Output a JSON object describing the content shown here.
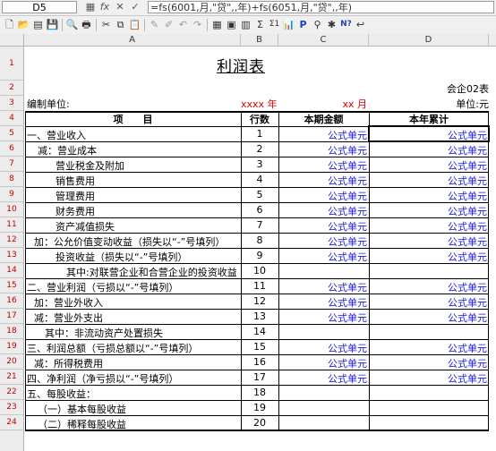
{
  "formula_bar": {
    "cell_ref": "D5",
    "fx_label": "fx",
    "cancel_label": "✕",
    "confirm_label": "✓",
    "formula": "=fs(6001,月,\"贷\",,年)+fs(6051,月,\"贷\",,年)"
  },
  "toolbar": {
    "sigma_label": "Σ",
    "sum_label": "Σ1",
    "p_label": "P",
    "help_label": "N?"
  },
  "columns": [
    "A",
    "B",
    "C",
    "D"
  ],
  "rows": [
    "1",
    "2",
    "3",
    "4",
    "5",
    "6",
    "7",
    "8",
    "9",
    "10",
    "11",
    "12",
    "13",
    "14",
    "15",
    "16",
    "17",
    "18",
    "19",
    "20",
    "21",
    "22",
    "23",
    "24"
  ],
  "sheet": {
    "title": "利润表",
    "form_no": "会企02表",
    "unit_left": "编制单位:",
    "year_field": "xxxx 年",
    "month_field": "xx 月",
    "unit_right": "单位:元",
    "headers": {
      "item": "项　　目",
      "line": "行数",
      "current": "本期金额",
      "ytd": "本年累计"
    },
    "items": [
      {
        "label": "一、营业收入",
        "line": "1",
        "current": "公式单元",
        "ytd": "公式单元"
      },
      {
        "label": "减：营业成本",
        "line": "2",
        "current": "公式单元",
        "ytd": "公式单元"
      },
      {
        "label": "营业税金及附加",
        "line": "3",
        "current": "公式单元",
        "ytd": "公式单元"
      },
      {
        "label": "销售费用",
        "line": "4",
        "current": "公式单元",
        "ytd": "公式单元"
      },
      {
        "label": "管理费用",
        "line": "5",
        "current": "公式单元",
        "ytd": "公式单元"
      },
      {
        "label": "财务费用",
        "line": "6",
        "current": "公式单元",
        "ytd": "公式单元"
      },
      {
        "label": "资产减值损失",
        "line": "7",
        "current": "公式单元",
        "ytd": "公式单元"
      },
      {
        "label": "加：公允价值变动收益（损失以“-”号填列）",
        "line": "8",
        "current": "公式单元",
        "ytd": "公式单元"
      },
      {
        "label": "投资收益（损失以“-”号填列）",
        "line": "9",
        "current": "公式单元",
        "ytd": "公式单元"
      },
      {
        "label": "其中:对联营企业和合营企业的投资收益",
        "line": "10",
        "current": "",
        "ytd": ""
      },
      {
        "label": "二、营业利润（亏损以“-”号填列）",
        "line": "11",
        "current": "公式单元",
        "ytd": "公式单元"
      },
      {
        "label": "加：营业外收入",
        "line": "12",
        "current": "公式单元",
        "ytd": "公式单元"
      },
      {
        "label": "减：营业外支出",
        "line": "13",
        "current": "公式单元",
        "ytd": "公式单元"
      },
      {
        "label": "其中：非流动资产处置损失",
        "line": "14",
        "current": "",
        "ytd": ""
      },
      {
        "label": "三、利润总额（亏损总额以“-”号填列）",
        "line": "15",
        "current": "公式单元",
        "ytd": "公式单元"
      },
      {
        "label": "减：所得税费用",
        "line": "16",
        "current": "公式单元",
        "ytd": "公式单元"
      },
      {
        "label": "四、净利润（净亏损以“-”号填列）",
        "line": "17",
        "current": "公式单元",
        "ytd": "公式单元"
      },
      {
        "label": "五、每股收益：",
        "line": "18",
        "current": "",
        "ytd": ""
      },
      {
        "label": "（一）基本每股收益",
        "line": "19",
        "current": "",
        "ytd": ""
      },
      {
        "label": "（二）稀释每股收益",
        "line": "20",
        "current": "",
        "ytd": ""
      }
    ]
  }
}
